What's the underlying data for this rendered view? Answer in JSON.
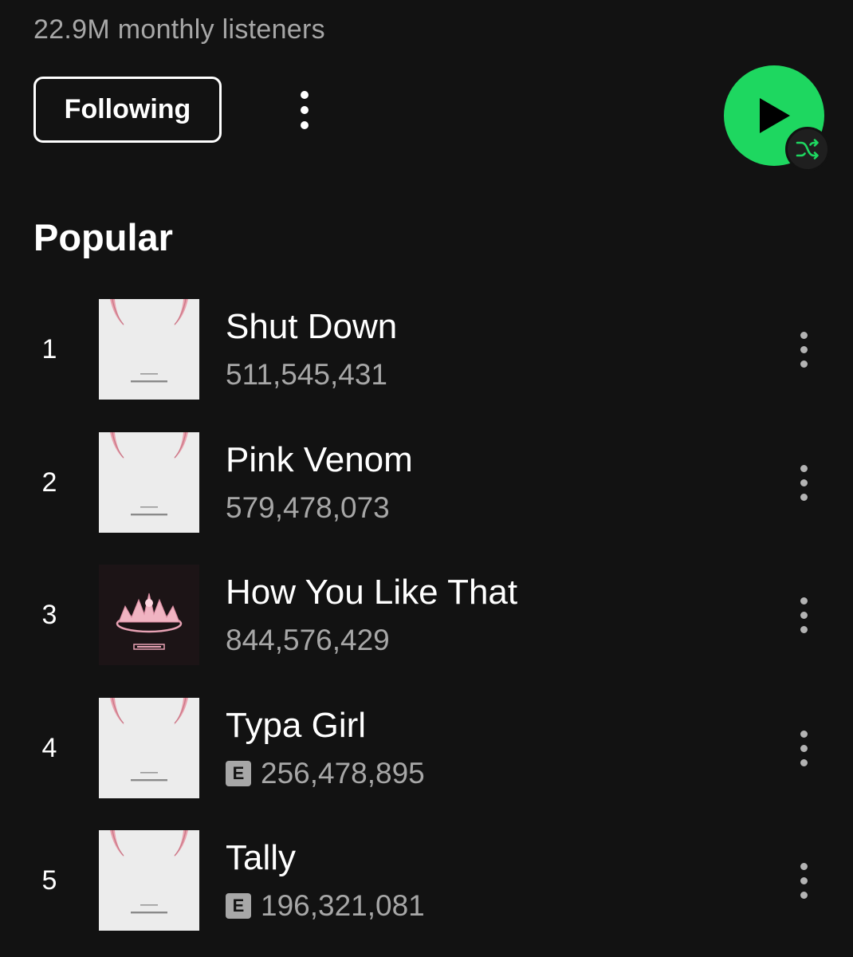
{
  "artist": {
    "monthly_listeners": "22.9M monthly listeners"
  },
  "actions": {
    "follow_label": "Following",
    "more_icon": "more-vertical-icon",
    "play_icon": "play-icon",
    "shuffle_icon": "shuffle-icon"
  },
  "colors": {
    "accent": "#1ed760",
    "background": "#121212",
    "secondary_text": "#a7a7a7"
  },
  "popular": {
    "title": "Popular",
    "tracks": [
      {
        "rank": "1",
        "title": "Shut Down",
        "plays": "511,545,431",
        "explicit": false,
        "cover": "born-pink-album-art"
      },
      {
        "rank": "2",
        "title": "Pink Venom",
        "plays": "579,478,073",
        "explicit": false,
        "cover": "born-pink-album-art"
      },
      {
        "rank": "3",
        "title": "How You Like That",
        "plays": "844,576,429",
        "explicit": false,
        "cover": "the-album-art"
      },
      {
        "rank": "4",
        "title": "Typa Girl",
        "plays": "256,478,895",
        "explicit": true,
        "explicit_label": "E",
        "cover": "born-pink-album-art"
      },
      {
        "rank": "5",
        "title": "Tally",
        "plays": "196,321,081",
        "explicit": true,
        "explicit_label": "E",
        "cover": "born-pink-album-art"
      }
    ]
  }
}
